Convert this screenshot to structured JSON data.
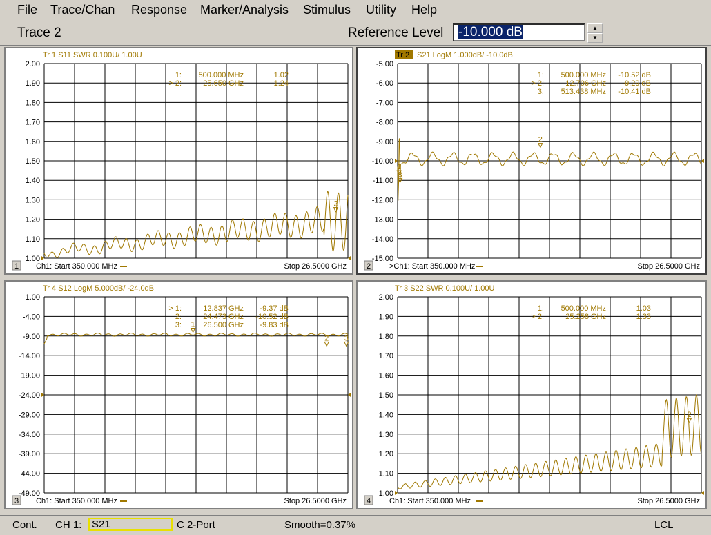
{
  "menu": [
    "File",
    "Trace/Chan",
    "Response",
    "Marker/Analysis",
    "Stimulus",
    "Utility",
    "Help"
  ],
  "entry": {
    "title": "Trace 2",
    "label": "Reference Level",
    "value": "-10.000 dB"
  },
  "colors": {
    "trace": "#a07800",
    "grid": "#000000",
    "text": "#a07800"
  },
  "panels": [
    {
      "id": 1,
      "header": "Tr  1  S11 SWR 0.100U/  1.00U",
      "header_active": false,
      "yticks": [
        "2.00",
        "1.90",
        "1.80",
        "1.70",
        "1.60",
        "1.50",
        "1.40",
        "1.30",
        "1.20",
        "1.10",
        "1.00"
      ],
      "markers": [
        [
          "1:",
          "500.000 MHz",
          "1.02"
        ],
        [
          "> 2:",
          "25.650 GHz",
          "1.24"
        ]
      ],
      "start": "Ch1: Start  350.000 MHz",
      "stop": "Stop  26.5000 GHz",
      "num": "1",
      "kind": "swr1",
      "marker_icons": [
        "2"
      ]
    },
    {
      "id": 2,
      "header_tr": "Tr  2",
      "header": "S21 LogM 1.000dB/  -10.0dB",
      "header_active": true,
      "yticks": [
        "-5.00",
        "-6.00",
        "-7.00",
        "-8.00",
        "-9.00",
        "-10.00",
        "-11.00",
        "-12.00",
        "-13.00",
        "-14.00",
        "-15.00"
      ],
      "markers": [
        [
          "1:",
          "500.000 MHz",
          "-10.52 dB"
        ],
        [
          "> 2:",
          "12.706 GHz",
          "-9.29 dB"
        ],
        [
          "3:",
          "513.438 MHz",
          "-10.41 dB"
        ]
      ],
      "start": ">Ch1: Start  350.000 MHz",
      "stop": "Stop  26.5000 GHz",
      "num": "2",
      "kind": "logm21",
      "marker_icons": [
        "2",
        "1",
        "3"
      ]
    },
    {
      "id": 4,
      "header": "Tr  4  S12 LogM 5.000dB/  -24.0dB",
      "header_active": false,
      "yticks": [
        "1.00",
        "-4.00",
        "-9.00",
        "-14.00",
        "-19.00",
        "-24.00",
        "-29.00",
        "-34.00",
        "-39.00",
        "-44.00",
        "-49.00"
      ],
      "markers": [
        [
          "> 1:",
          "12.837 GHz",
          "-9.37 dB"
        ],
        [
          "2:",
          "24.473 GHz",
          "-10.52 dB"
        ],
        [
          "3:",
          "26.500 GHz",
          "-9.83 dB"
        ]
      ],
      "start": "Ch1: Start  350.000 MHz",
      "stop": "Stop  26.5000 GHz",
      "num": "3",
      "kind": "logm12",
      "marker_icons": [
        "1",
        "2",
        "3"
      ]
    },
    {
      "id": 3,
      "header": "Tr  3  S22 SWR 0.100U/  1.00U",
      "header_active": false,
      "yticks": [
        "2.00",
        "1.90",
        "1.80",
        "1.70",
        "1.60",
        "1.50",
        "1.40",
        "1.30",
        "1.20",
        "1.10",
        "1.00"
      ],
      "markers": [
        [
          "1:",
          "500.000 MHz",
          "1.03"
        ],
        [
          "> 2:",
          "25.258 GHz",
          "1.33"
        ]
      ],
      "start": "Ch1: Start  350.000 MHz",
      "stop": "Stop  26.5000 GHz",
      "num": "4",
      "kind": "swr2",
      "marker_icons": [
        "2"
      ]
    }
  ],
  "status": {
    "mode": "Cont.",
    "ch": "CH 1:",
    "param": "S21",
    "cal": "C  2-Port",
    "smooth": "Smooth=0.37%",
    "lcl": "LCL"
  }
}
